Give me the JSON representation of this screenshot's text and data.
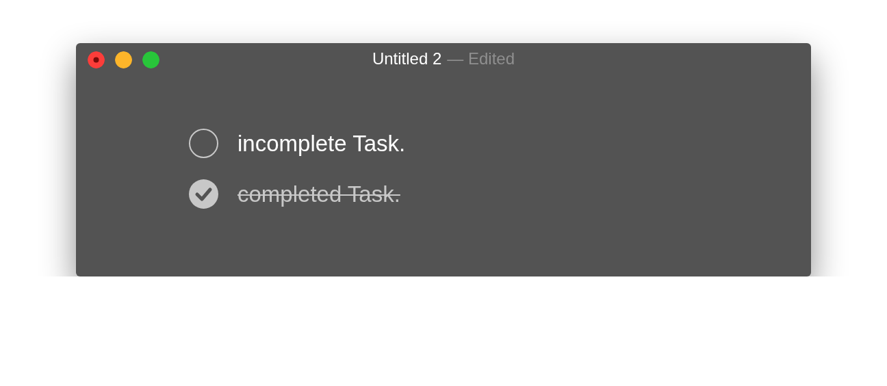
{
  "window": {
    "title": "Untitled 2",
    "edited_label": "— Edited"
  },
  "tasks": [
    {
      "text": "incomplete Task.",
      "checked": false
    },
    {
      "text": "completed Task.",
      "checked": true
    }
  ]
}
